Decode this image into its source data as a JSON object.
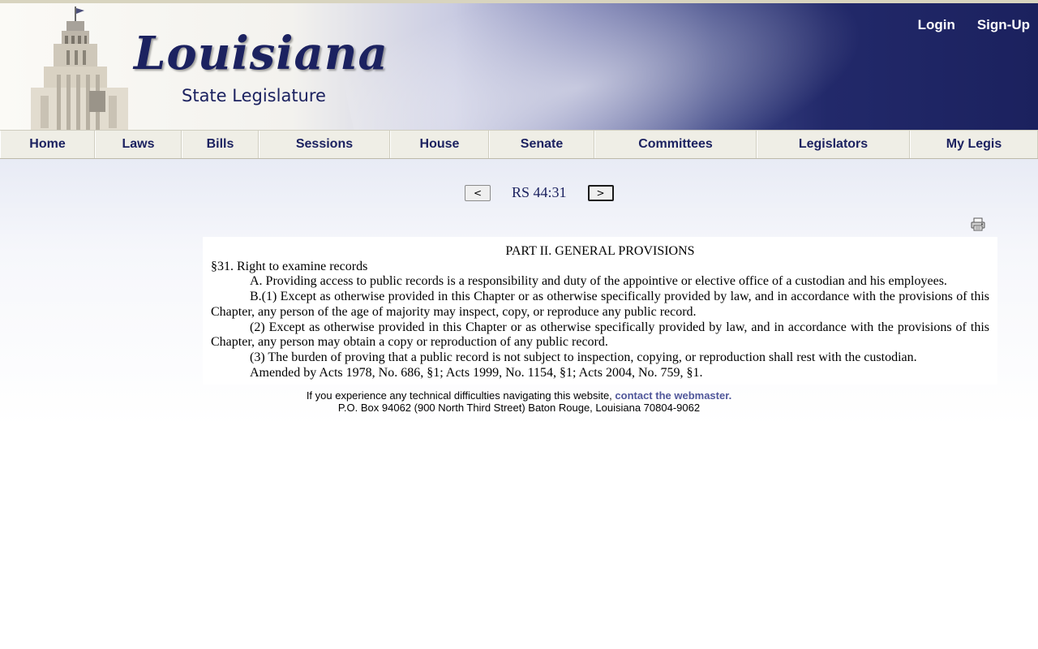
{
  "header": {
    "logo_script": "Louisiana",
    "logo_subtitle": "State Legislature",
    "login": "Login",
    "signup": "Sign-Up"
  },
  "nav": [
    {
      "label": "Home"
    },
    {
      "label": "Laws"
    },
    {
      "label": "Bills"
    },
    {
      "label": "Sessions"
    },
    {
      "label": "House"
    },
    {
      "label": "Senate"
    },
    {
      "label": "Committees"
    },
    {
      "label": "Legislators"
    },
    {
      "label": "My Legis"
    }
  ],
  "pager": {
    "prev_label": "<",
    "next_label": ">",
    "current": "RS 44:31"
  },
  "document": {
    "part_heading": "PART II.  GENERAL PROVISIONS",
    "section_title": "§31.  Right to examine records",
    "para_a": "A.  Providing access to public records is a responsibility and duty of the appointive or elective office of a custodian and his employees.",
    "para_b1": "B.(1)  Except as otherwise provided in this Chapter or as otherwise specifically provided by law, and in accordance with the provisions of this Chapter, any person of the age of majority may inspect, copy, or reproduce any public record.",
    "para_b2": "(2)  Except as otherwise provided in this Chapter or as otherwise specifically provided by law, and in accordance with the provisions of this Chapter, any person may obtain a copy or reproduction of any public record.",
    "para_b3": "(3)  The burden of proving that a public record is not subject to inspection, copying, or reproduction shall rest with the custodian.",
    "history": "Amended by Acts 1978, No. 686, §1; Acts 1999, No. 1154, §1; Acts 2004, No. 759, §1."
  },
  "footer": {
    "line1_text": "If you experience any technical difficulties navigating this website, ",
    "line1_link": "contact the webmaster.",
    "line2": "P.O. Box 94062 (900 North Third Street) Baton Rouge, Louisiana 70804-9062"
  },
  "colors": {
    "nav_text": "#1c2260",
    "header_dark": "#1b215e",
    "link": "#50579a"
  },
  "icons": {
    "print": "printer-icon"
  }
}
